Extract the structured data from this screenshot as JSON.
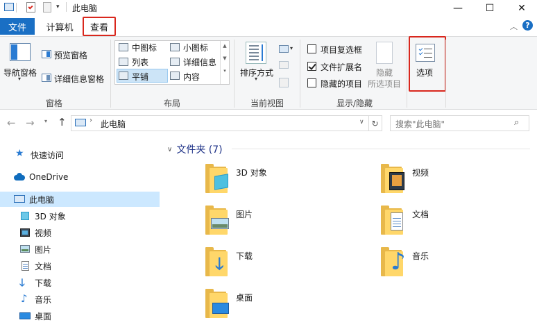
{
  "window": {
    "title": "此电脑",
    "minimize_glyph": "—",
    "maximize_glyph": "☐",
    "close_glyph": "✕"
  },
  "tabs": {
    "file": "文件",
    "computer": "计算机",
    "view": "查看"
  },
  "ribbon": {
    "panes": {
      "label": "窗格",
      "nav_pane": "导航窗格",
      "preview_pane": "预览窗格",
      "details_pane": "详细信息窗格"
    },
    "layout": {
      "label": "布局",
      "items": [
        {
          "label": "中图标"
        },
        {
          "label": "小图标"
        },
        {
          "label": "列表"
        },
        {
          "label": "详细信息"
        },
        {
          "label": "平铺"
        },
        {
          "label": "内容"
        }
      ]
    },
    "current_view": {
      "label": "当前视图",
      "sort_by": "排序方式"
    },
    "show_hide": {
      "label": "显示/隐藏",
      "item_checkboxes": {
        "label": "项目复选框",
        "checked": false
      },
      "file_extensions": {
        "label": "文件扩展名",
        "checked": true
      },
      "hidden_items": {
        "label": "隐藏的项目",
        "checked": false
      },
      "hide_selected_line1": "隐藏",
      "hide_selected_line2": "所选项目"
    },
    "options": "选项"
  },
  "address": {
    "path": "此电脑",
    "search_placeholder": "搜索\"此电脑\""
  },
  "sidebar": {
    "items": [
      {
        "label": "快速访问",
        "icon": "star-icon"
      },
      {
        "label": "OneDrive",
        "icon": "cloud-icon"
      },
      {
        "label": "此电脑",
        "icon": "computer-icon",
        "selected": true
      },
      {
        "label": "3D 对象",
        "icon": "cube-icon"
      },
      {
        "label": "视频",
        "icon": "video-icon"
      },
      {
        "label": "图片",
        "icon": "picture-icon"
      },
      {
        "label": "文档",
        "icon": "document-icon"
      },
      {
        "label": "下载",
        "icon": "download-icon"
      },
      {
        "label": "音乐",
        "icon": "music-icon"
      },
      {
        "label": "桌面",
        "icon": "desktop-icon"
      }
    ]
  },
  "content": {
    "section_title": "文件夹 (7)",
    "folders": [
      {
        "label": "3D 对象",
        "icon": "cube-icon"
      },
      {
        "label": "视频",
        "icon": "video-icon"
      },
      {
        "label": "图片",
        "icon": "picture-icon"
      },
      {
        "label": "文档",
        "icon": "document-icon"
      },
      {
        "label": "下载",
        "icon": "download-icon"
      },
      {
        "label": "音乐",
        "icon": "music-icon"
      },
      {
        "label": "桌面",
        "icon": "desktop-icon"
      }
    ]
  },
  "colors": {
    "accent": "#1a6fc4",
    "highlight_box": "#d9271d",
    "selection": "#cce8ff",
    "folder": "#ffd76a"
  }
}
